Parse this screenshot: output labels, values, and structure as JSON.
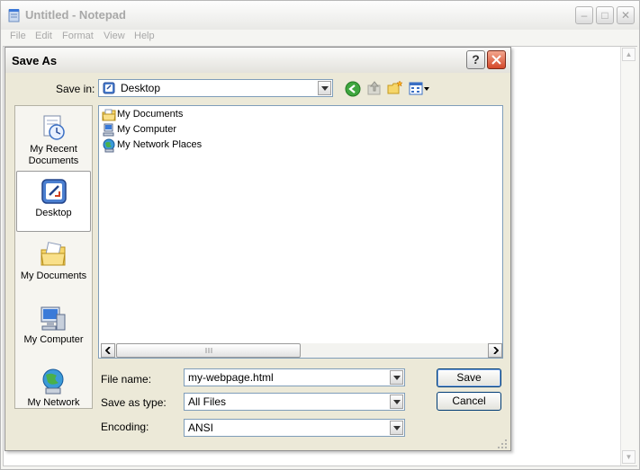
{
  "notepad": {
    "title": "Untitled - Notepad",
    "menu": [
      "File",
      "Edit",
      "Format",
      "View",
      "Help"
    ]
  },
  "dialog": {
    "title": "Save As",
    "help_label": "?",
    "save_in_label": "Save in:",
    "save_in_value": "Desktop",
    "places": [
      "My Recent Documents",
      "Desktop",
      "My Documents",
      "My Computer",
      "My Network"
    ],
    "selected_place": "Desktop",
    "files": [
      "My Documents",
      "My Computer",
      "My Network Places"
    ],
    "file_name_label": "File name:",
    "file_name_value": "my-webpage.html",
    "save_type_label": "Save as type:",
    "save_type_value": "All Files",
    "encoding_label": "Encoding:",
    "encoding_value": "ANSI",
    "save_button": "Save",
    "cancel_button": "Cancel"
  },
  "colors": {
    "accent_blue": "#316ac5",
    "close_red": "#d4482a",
    "dialog_bg": "#ece9d8"
  }
}
